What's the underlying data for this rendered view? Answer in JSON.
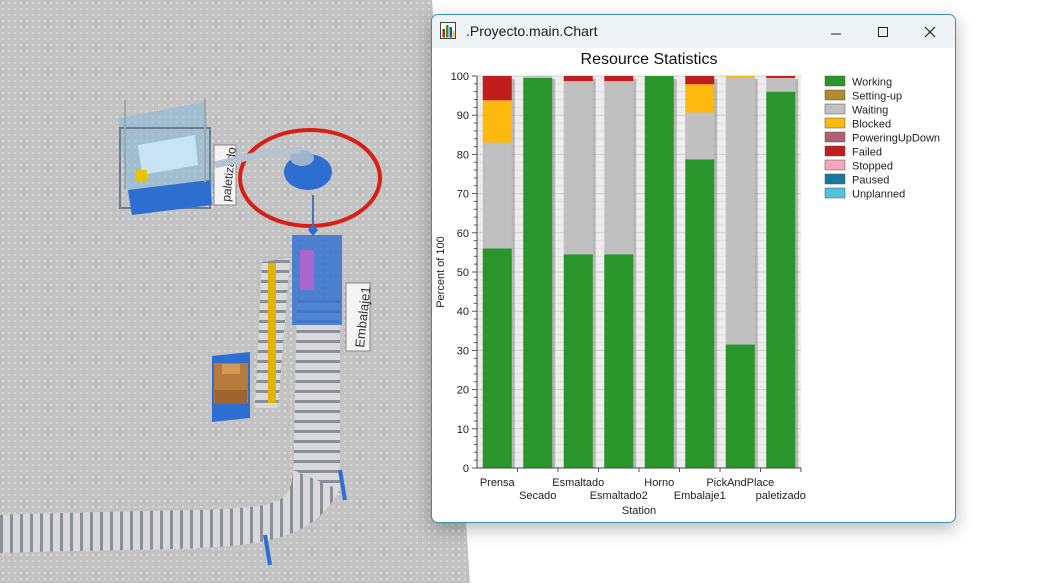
{
  "window": {
    "title": ".Proyecto.main.Chart",
    "icons": {
      "app": "bar-chart-icon",
      "minimize": "minimize-icon",
      "maximize": "maximize-icon",
      "close": "close-icon"
    }
  },
  "scene": {
    "labels": {
      "palletizer": "paletizado",
      "packing": "Embalaje1"
    }
  },
  "colors": {
    "Working": "#2a952a",
    "Setting-up": "#b08a2f",
    "Waiting": "#c0c0c0",
    "Blocked": "#fdb90d",
    "PoweringUpDown": "#b06075",
    "Failed": "#c21d1d",
    "Stopped": "#f5a5c0",
    "Paused": "#1978a0",
    "Unplanned": "#4ec3dc",
    "window_border": "#3a8ea8"
  },
  "chart_data": {
    "type": "bar",
    "stacked": true,
    "title": "Resource Statistics",
    "xlabel": "Station",
    "ylabel": "Percent of 100",
    "ylim": [
      0,
      100
    ],
    "yticks": [
      0,
      10,
      20,
      30,
      40,
      50,
      60,
      70,
      80,
      90,
      100
    ],
    "grid": true,
    "legend_position": "right",
    "categories": [
      "Prensa",
      "Secado",
      "Esmaltado",
      "Esmaltado2",
      "Horno",
      "Embalaje1",
      "PickAndPlace",
      "paletizado"
    ],
    "series": [
      {
        "name": "Working",
        "values": [
          56,
          99.5,
          54.5,
          54.5,
          100,
          78.7,
          31.5,
          96
        ]
      },
      {
        "name": "Setting-up",
        "values": [
          0,
          0,
          0,
          0,
          0,
          0,
          0,
          0
        ]
      },
      {
        "name": "Waiting",
        "values": [
          27,
          0.5,
          44.2,
          44.2,
          0,
          12,
          68,
          3.5
        ]
      },
      {
        "name": "Blocked",
        "values": [
          10.8,
          0,
          0,
          0,
          0,
          7.2,
          0.5,
          0
        ]
      },
      {
        "name": "PoweringUpDown",
        "values": [
          0,
          0,
          0,
          0,
          0,
          0,
          0,
          0
        ]
      },
      {
        "name": "Failed",
        "values": [
          6.2,
          0,
          1.3,
          1.3,
          0,
          2.1,
          0,
          0.5
        ]
      },
      {
        "name": "Stopped",
        "values": [
          0,
          0,
          0,
          0,
          0,
          0,
          0,
          0
        ]
      },
      {
        "name": "Paused",
        "values": [
          0,
          0,
          0,
          0,
          0,
          0,
          0,
          0
        ]
      },
      {
        "name": "Unplanned",
        "values": [
          0,
          0,
          0,
          0,
          0,
          0,
          0,
          0
        ]
      }
    ]
  }
}
